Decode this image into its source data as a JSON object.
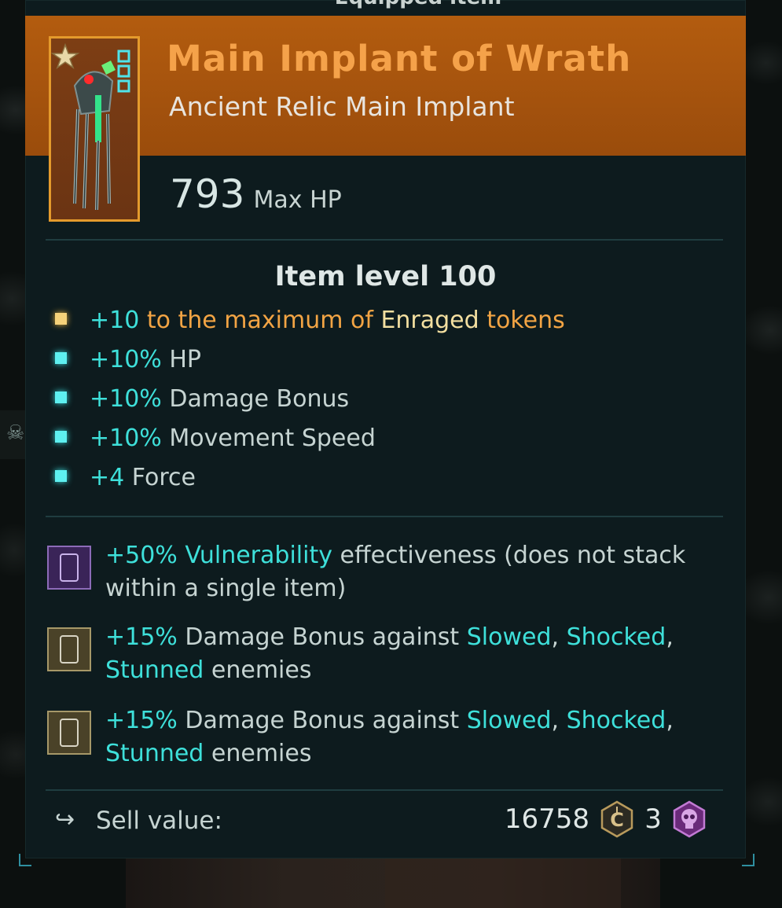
{
  "header": {
    "caption": "Equipped item"
  },
  "item": {
    "name": "Main Implant of Wrath",
    "type": "Ancient Relic Main Implant",
    "stat_value": "793",
    "stat_label": "Max HP",
    "item_level": "Item level 100",
    "icon": "implant-icon"
  },
  "mods": [
    {
      "bullet": "gold",
      "parts": [
        "+10",
        "to the maximum of",
        "Enraged",
        "tokens"
      ]
    },
    {
      "bullet": "cyan",
      "value": "+10%",
      "label": "HP"
    },
    {
      "bullet": "cyan",
      "value": "+10%",
      "label": "Damage Bonus"
    },
    {
      "bullet": "cyan",
      "value": "+10%",
      "label": "Movement Speed"
    },
    {
      "bullet": "cyan",
      "value": "+4",
      "label": "Force"
    }
  ],
  "augments": [
    {
      "icon": "purple-rune-icon",
      "value": "+50%",
      "keyword": "Vulnerability",
      "text": "effectiveness (does not stack within a single item)"
    },
    {
      "icon": "tan-rune-icon",
      "value": "+15%",
      "text1": "Damage Bonus against",
      "k1": "Slowed",
      "k2": "Shocked",
      "k3": "Stunned",
      "text2": "enemies"
    },
    {
      "icon": "tan-rune-icon",
      "value": "+15%",
      "text1": "Damage Bonus against",
      "k1": "Slowed",
      "k2": "Shocked",
      "k3": "Stunned",
      "text2": "enemies"
    }
  ],
  "sell": {
    "label": "Sell value:",
    "credits": "16758",
    "credits_icon": "credits-coin-icon",
    "skulls": "3",
    "skulls_icon": "purple-skull-coin-icon"
  },
  "colors": {
    "banner": "#b35c0f",
    "title": "#f5a24a",
    "keyword": "#3ee0da",
    "panel": "#0d1b1e"
  }
}
